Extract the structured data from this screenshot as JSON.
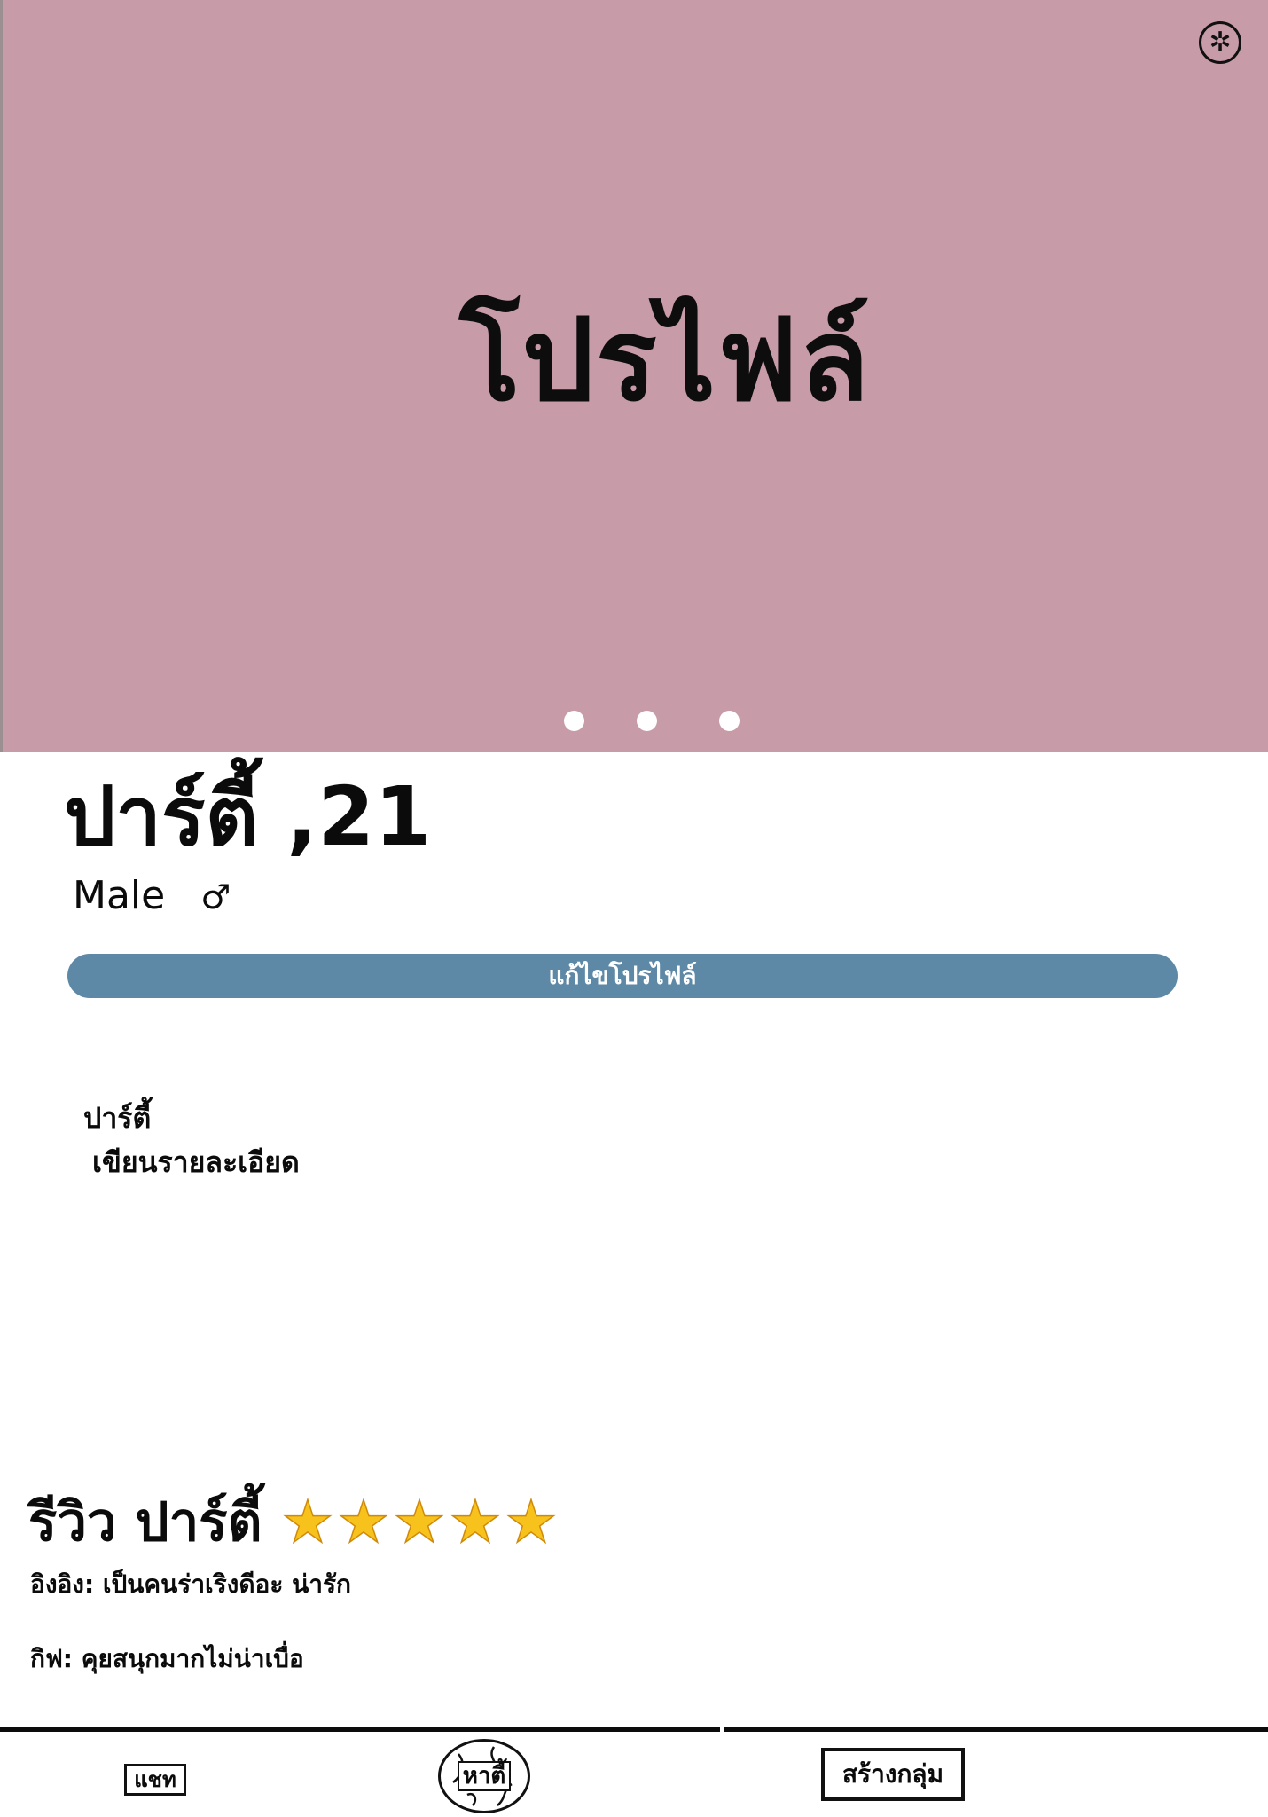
{
  "header": {
    "title": "โปรไฟล์",
    "settings_icon": "gear-icon",
    "photo_count": 3
  },
  "profile": {
    "name_age": "ปาร์ตี้ ,21",
    "gender": "Male",
    "gender_symbol": "♂",
    "edit_button_label": "แก้ไขโปรไฟล์",
    "bio_name": "ปาร์ตี้",
    "bio_text": "เขียนรายละเอียด"
  },
  "reviews": {
    "title": "รีวิว ปาร์ตี้",
    "rating": 5,
    "rating_max": 5,
    "items": [
      {
        "text": "อิงอิง: เป็นคนร่าเริงดีอะ น่ารัก"
      },
      {
        "text": "กิฟ: คุยสนุกมากไม่น่าเบื่อ"
      }
    ]
  },
  "bottom_nav": {
    "chat_label": "แชท",
    "find_label": "หาตี้",
    "create_group_label": "สร้างกลุ่ม"
  },
  "colors": {
    "hero_background": "#c79ba7",
    "edit_button": "#5e89a6",
    "star": "#f7c21c"
  }
}
